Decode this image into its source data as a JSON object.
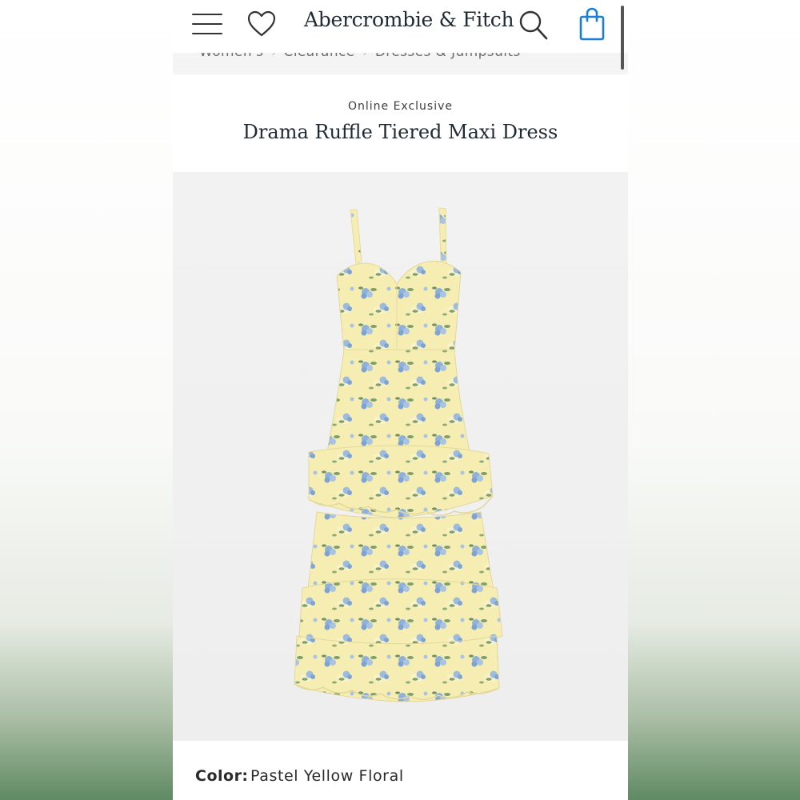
{
  "header": {
    "logo": "Abercrombie & Fitch",
    "icons": [
      "menu-icon",
      "heart-icon",
      "search-icon",
      "shopping-bag-icon"
    ],
    "bag_color": "#1a7fd8"
  },
  "breadcrumb": {
    "items": [
      "Women's",
      "Clearance",
      "Dresses & Jumpsuits"
    ],
    "separator_icon": "chevron-right-icon"
  },
  "product": {
    "badge": "Online Exclusive",
    "title": "Drama Ruffle Tiered Maxi Dress",
    "image_alt": "yellow floral tiered maxi dress",
    "color_label": "Color:",
    "color_value": "Pastel Yellow Floral"
  },
  "colors": {
    "accent": "#1a7fd8",
    "dress_base": "#f6edb2",
    "flower_blue": "#8fb1d9",
    "leaf_green": "#7f9f6d"
  }
}
